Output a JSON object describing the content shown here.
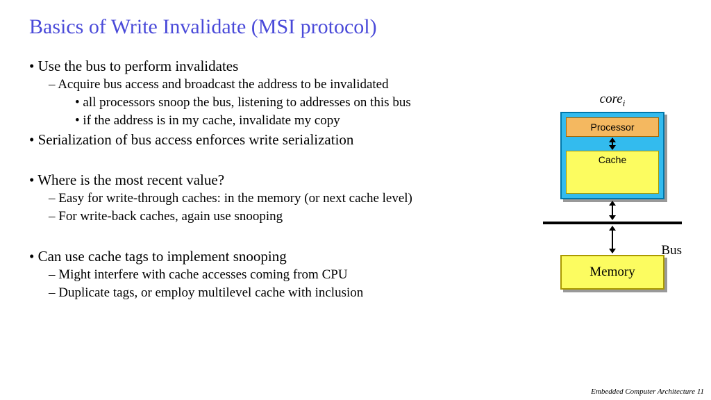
{
  "title": "Basics of Write Invalidate (MSI protocol)",
  "bullets": {
    "b1_1": "Use the bus to perform invalidates",
    "b2_1": "Acquire bus access and broadcast the address to be invalidated",
    "b3_1": "all processors snoop the bus, listening to addresses on this bus",
    "b3_2": "if the address is in my cache, invalidate my copy",
    "b1_2": "Serialization of bus access enforces write serialization",
    "b1_3": "Where is the most recent value?",
    "b2_2": "Easy for write-through caches: in the memory (or next cache level)",
    "b2_3": "For write-back caches, again use snooping",
    "b1_4": "Can use cache tags to implement snooping",
    "b2_4": "Might interfere with cache accesses coming from CPU",
    "b2_5": "Duplicate tags, or employ multilevel cache with inclusion"
  },
  "diagram": {
    "core_label": "core",
    "core_sub": "i",
    "processor": "Processor",
    "cache": "Cache",
    "bus": "Bus",
    "memory": "Memory"
  },
  "footer": "Embedded Computer Architecture  11"
}
